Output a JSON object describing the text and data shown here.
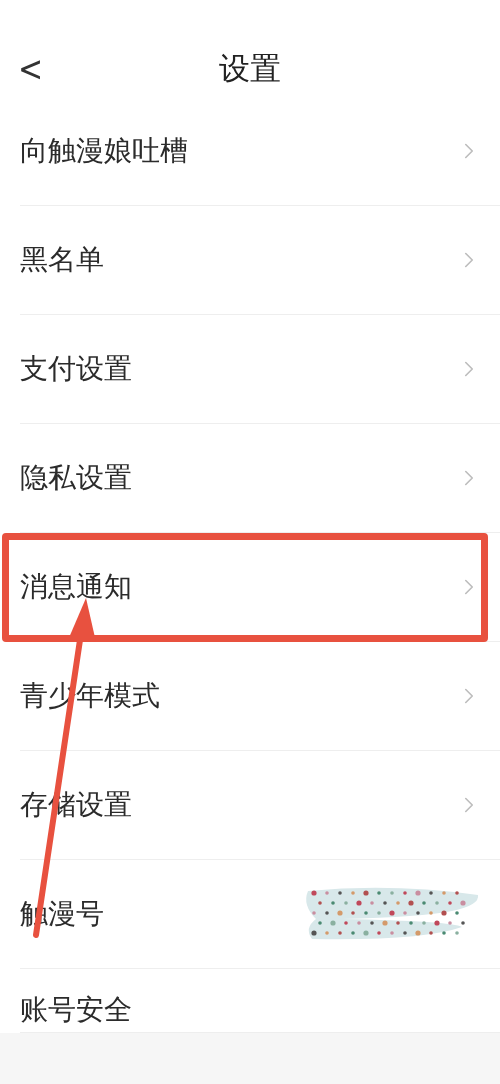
{
  "header": {
    "back": "<",
    "title": "设置"
  },
  "items": [
    {
      "label": "向触漫娘吐槽",
      "kind": "link",
      "highlighted": false
    },
    {
      "label": "黑名单",
      "kind": "link",
      "highlighted": false
    },
    {
      "label": "支付设置",
      "kind": "link",
      "highlighted": false
    },
    {
      "label": "隐私设置",
      "kind": "link",
      "highlighted": false
    },
    {
      "label": "消息通知",
      "kind": "link",
      "highlighted": true
    },
    {
      "label": "青少年模式",
      "kind": "link",
      "highlighted": false
    },
    {
      "label": "存储设置",
      "kind": "link",
      "highlighted": false
    },
    {
      "label": "触漫号",
      "kind": "redacted",
      "highlighted": false
    },
    {
      "label": "账号安全",
      "kind": "cut",
      "highlighted": false
    }
  ],
  "annotation": {
    "kind": "arrow"
  }
}
